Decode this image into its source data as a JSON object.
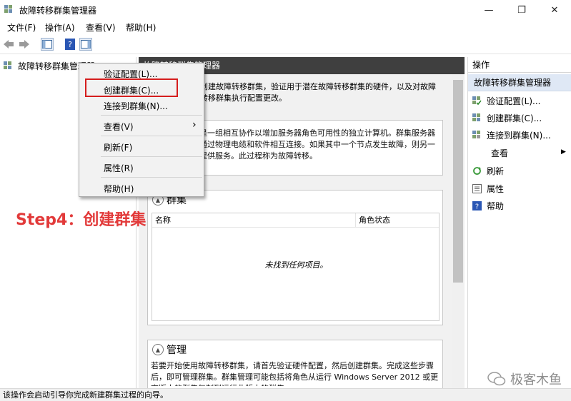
{
  "window": {
    "title": "故障转移群集管理器",
    "minimize": "—",
    "maximize": "❐",
    "close": "✕"
  },
  "menu": [
    "文件(F)",
    "操作(A)",
    "查看(V)",
    "帮助(H)"
  ],
  "tree": {
    "root": "故障转移群集管理器"
  },
  "center": {
    "header": "故障转移群集管理器",
    "intro": "创建故障转移群集，验证用于潜在故障转移群集的硬件，以及对故障转移群集执行配置更改。",
    "overview_text": "故障转移群集是一组相互协作以增加服务器角色可用性的独立计算机。群集服务器（称为节点）通过物理电缆和软件相互连接。如果其中一个节点发生故障，则另一个节点将开始提供服务。此过程称为故障转移。",
    "clusters_title": "群集",
    "clusters_columns": [
      "名称",
      "角色状态"
    ],
    "clusters_empty": "未找到任何项目。",
    "manage_title": "管理",
    "manage_text": "若要开始使用故障转移群集，请首先验证硬件配置，然后创建群集。完成这些步骤后，即可管理群集。群集管理可能包括将角色从运行 Windows Server 2012 或更高版本的群集复制到运行此版本的群集。"
  },
  "actions": {
    "header": "操作",
    "section": "故障转移群集管理器",
    "items": [
      {
        "label": "验证配置(L)...",
        "icon": "validate-icon"
      },
      {
        "label": "创建群集(C)...",
        "icon": "create-cluster-icon"
      },
      {
        "label": "连接到群集(N)...",
        "icon": "connect-cluster-icon"
      },
      {
        "label": "查看",
        "icon": "none"
      },
      {
        "label": "刷新",
        "icon": "refresh-icon"
      },
      {
        "label": "属性",
        "icon": "properties-icon"
      },
      {
        "label": "帮助",
        "icon": "help-icon"
      }
    ]
  },
  "context_menu": {
    "items": [
      "验证配置(L)...",
      "创建群集(C)...",
      "连接到群集(N)...",
      "查看(V)",
      "刷新(F)",
      "属性(R)",
      "帮助(H)"
    ],
    "arrow": "›"
  },
  "annotation": "Step4：创建群集",
  "status": "该操作会启动引导你完成新建群集过程的向导。",
  "watermark": "极客木鱼"
}
